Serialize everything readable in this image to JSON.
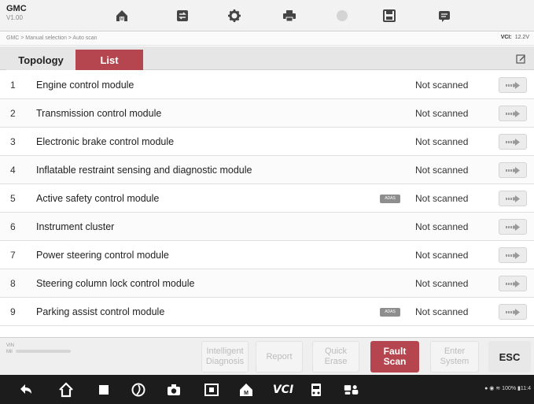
{
  "header": {
    "brand": "GMC",
    "version": "V1.00",
    "toolbar_icons": [
      "home-icon",
      "vehicle-swap-icon",
      "settings-icon",
      "print-icon",
      "help-icon",
      "save-icon",
      "data-logging-icon"
    ]
  },
  "breadcrumb": {
    "text": "GMC > Manual selection > Auto scan",
    "vci_label": "VCI:",
    "vci_value": "12.2V"
  },
  "tabs": [
    {
      "label": "Topology",
      "active": false
    },
    {
      "label": "List",
      "active": true
    }
  ],
  "modules": [
    {
      "num": "1",
      "name": "Engine control module",
      "status": "Not scanned",
      "tag": ""
    },
    {
      "num": "2",
      "name": "Transmission control module",
      "status": "Not scanned",
      "tag": ""
    },
    {
      "num": "3",
      "name": "Electronic brake control module",
      "status": "Not scanned",
      "tag": ""
    },
    {
      "num": "4",
      "name": "Inflatable restraint sensing and diagnostic module",
      "status": "Not scanned",
      "tag": ""
    },
    {
      "num": "5",
      "name": "Active safety control module",
      "status": "Not scanned",
      "tag": "ADAS"
    },
    {
      "num": "6",
      "name": "Instrument cluster",
      "status": "Not scanned",
      "tag": ""
    },
    {
      "num": "7",
      "name": "Power steering control module",
      "status": "Not scanned",
      "tag": ""
    },
    {
      "num": "8",
      "name": "Steering column lock control module",
      "status": "Not scanned",
      "tag": ""
    },
    {
      "num": "9",
      "name": "Parking assist control module",
      "status": "Not scanned",
      "tag": "ADAS"
    }
  ],
  "info": {
    "vin_label": "VIN",
    "mileage_label": "Mil"
  },
  "actions": {
    "intelligent_line1": "Intelligent",
    "intelligent_line2": "Diagnosis",
    "report": "Report",
    "quick_erase_line1": "Quick",
    "quick_erase_line2": "Erase",
    "fault_scan_line1": "Fault",
    "fault_scan_line2": "Scan",
    "enter_system_line1": "Enter",
    "enter_system_line2": "System",
    "esc": "ESC"
  },
  "colors": {
    "accent": "#b5464f",
    "navbar": "#1c1c1c"
  },
  "navbar": {
    "vci_text": "VCI",
    "status": "100%",
    "time": "11:4"
  }
}
